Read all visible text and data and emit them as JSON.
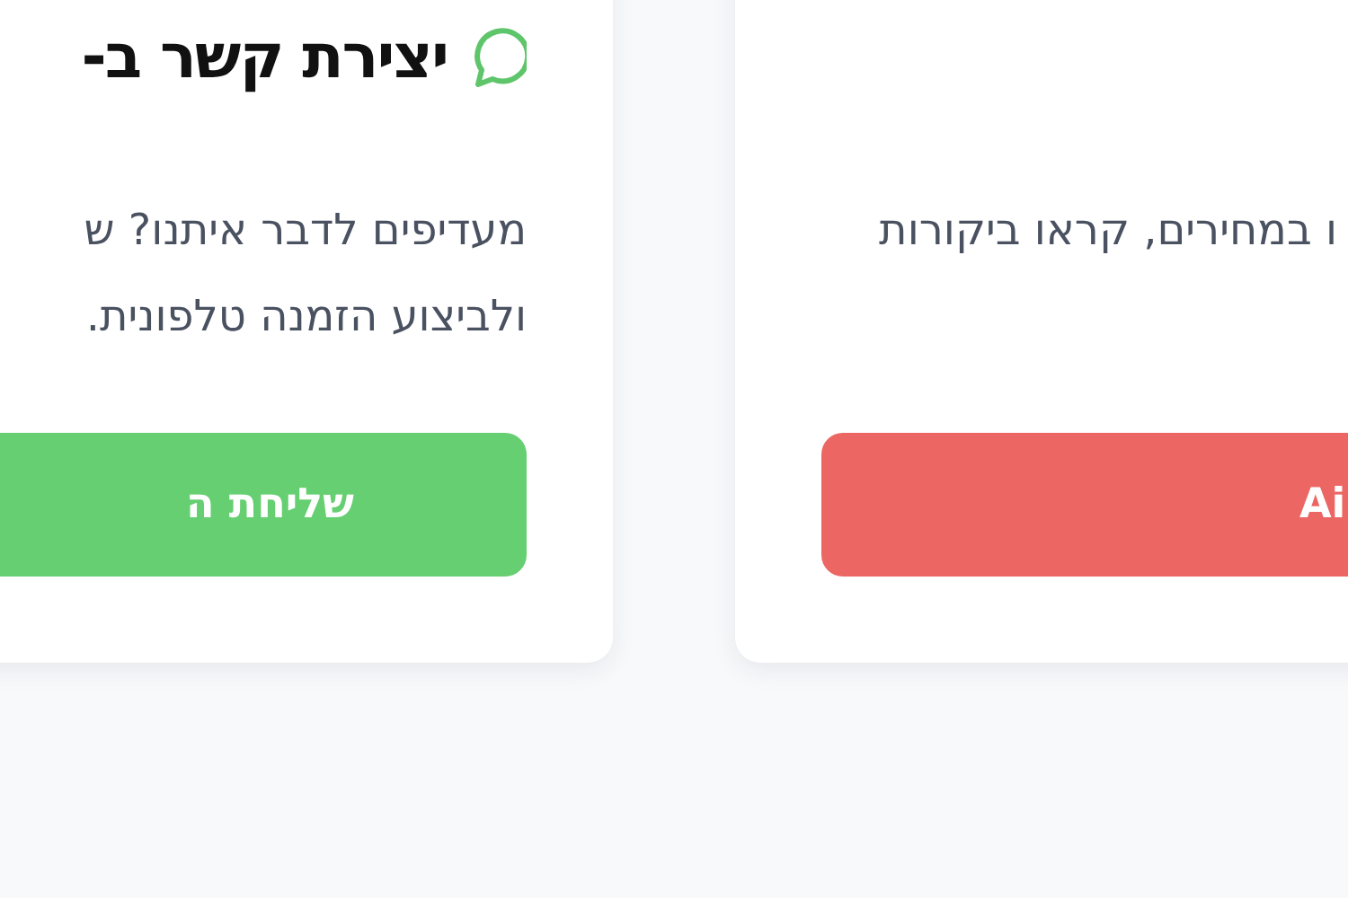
{
  "cards": [
    {
      "description": [
        "ו במחירים, קראו ביקורות"
      ],
      "button": {
        "label": "Ai",
        "color": "#ec6663"
      }
    },
    {
      "title": "יצירת קשר ב-",
      "description": [
        "מעדיפים לדבר איתנו? ש",
        "ולביצוע הזמנה טלפונית."
      ],
      "button": {
        "label": "שליחת ה",
        "color": "#66cf72"
      }
    }
  ]
}
